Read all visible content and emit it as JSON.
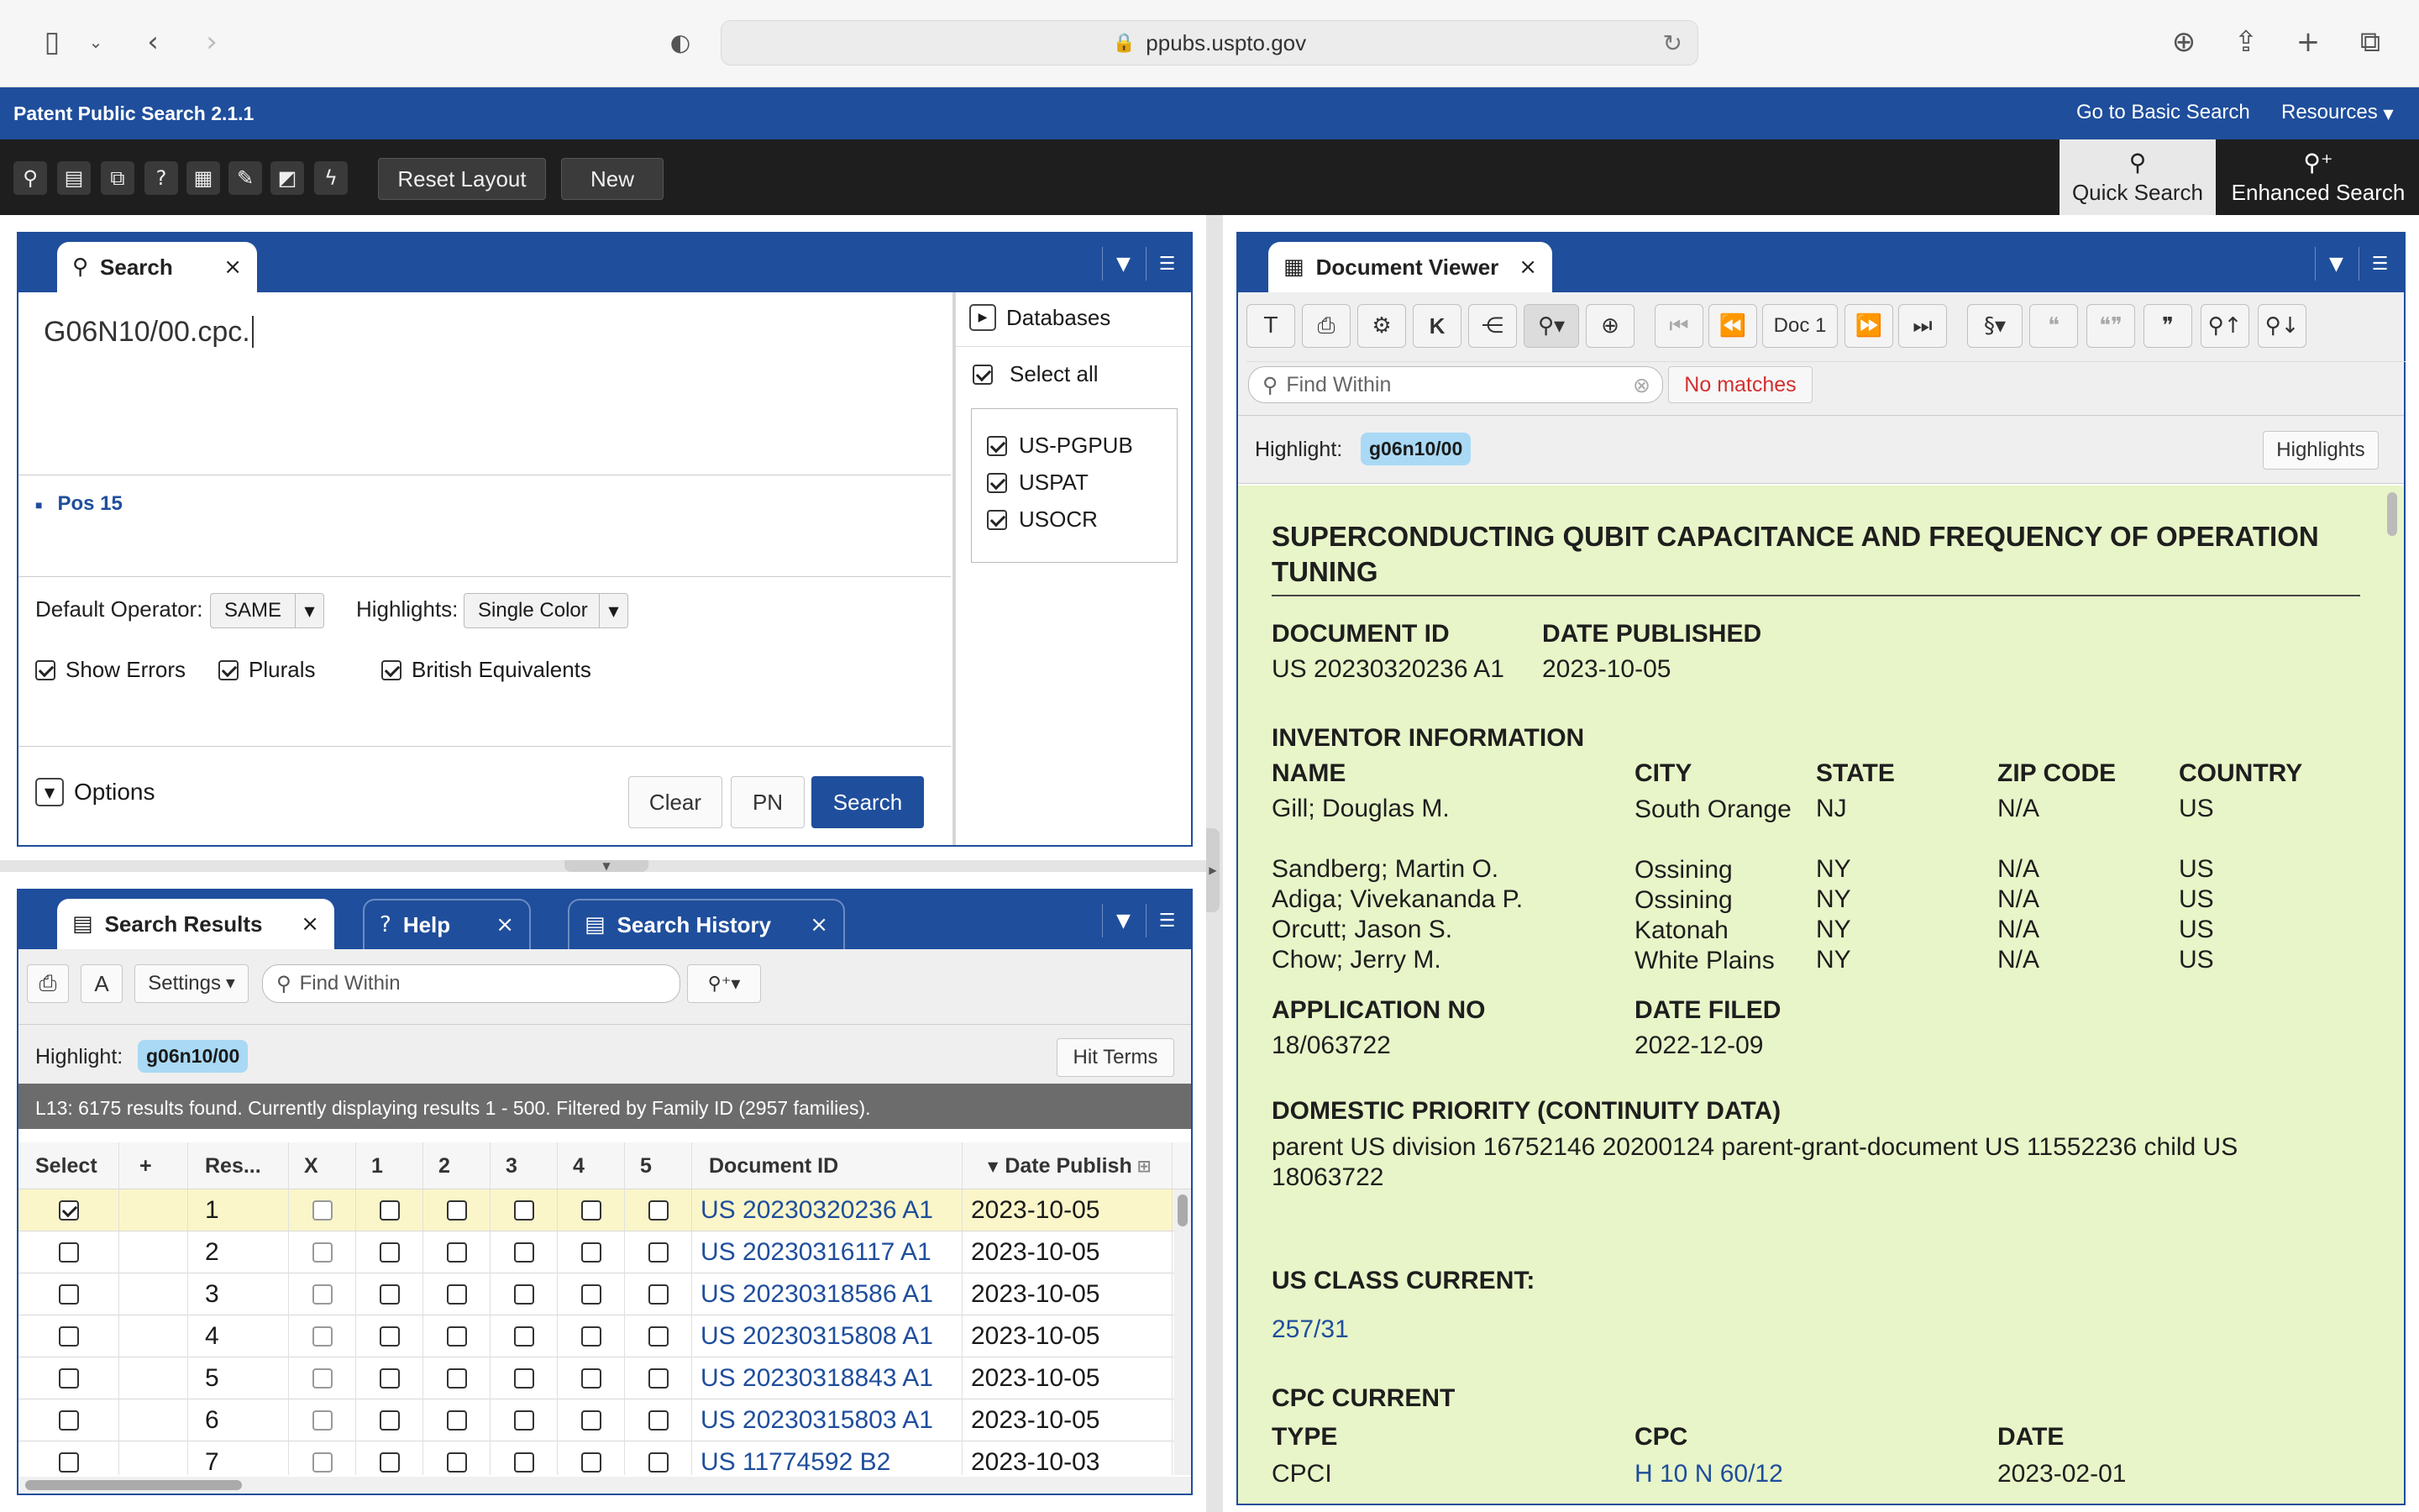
{
  "browser": {
    "url": "ppubs.uspto.gov"
  },
  "app": {
    "title": "Patent Public Search 2.1.1",
    "basic_search_link": "Go to Basic Search",
    "resources_menu": "Resources"
  },
  "toolbar": {
    "reset_layout": "Reset Layout",
    "new": "New",
    "quick_search": "Quick Search",
    "enhanced_search": "Enhanced Search"
  },
  "search_panel": {
    "tab_label": "Search",
    "query": "G06N10/00.cpc.",
    "cursor_info": "Pos 15",
    "default_operator_label": "Default Operator:",
    "default_operator_value": "SAME",
    "highlights_label": "Highlights:",
    "highlights_value": "Single Color",
    "show_errors": "Show Errors",
    "plurals": "Plurals",
    "british_equivalents": "British Equivalents",
    "options": "Options",
    "clear": "Clear",
    "pn": "PN",
    "search": "Search",
    "databases": {
      "title": "Databases",
      "select_all": "Select all",
      "items": [
        "US-PGPUB",
        "USPAT",
        "USOCR"
      ]
    }
  },
  "results_panel": {
    "tabs": [
      "Search Results",
      "Help",
      "Search History"
    ],
    "settings": "Settings",
    "find_within_placeholder": "Find Within",
    "highlight_label": "Highlight:",
    "highlight_term": "g06n10/00",
    "hit_terms": "Hit Terms",
    "status": "L13:  6175 results found. Currently displaying results 1 - 500. Filtered by Family ID (2957 families).",
    "columns": [
      "Select",
      "+",
      "Res...",
      "X",
      "1",
      "2",
      "3",
      "4",
      "5",
      "Document ID",
      "Date Publish"
    ],
    "rows": [
      {
        "num": "1",
        "doc_id": "US 20230320236 A1",
        "date": "2023-10-05",
        "selected": true
      },
      {
        "num": "2",
        "doc_id": "US 20230316117 A1",
        "date": "2023-10-05",
        "selected": false
      },
      {
        "num": "3",
        "doc_id": "US 20230318586 A1",
        "date": "2023-10-05",
        "selected": false
      },
      {
        "num": "4",
        "doc_id": "US 20230315808 A1",
        "date": "2023-10-05",
        "selected": false
      },
      {
        "num": "5",
        "doc_id": "US 20230318843 A1",
        "date": "2023-10-05",
        "selected": false
      },
      {
        "num": "6",
        "doc_id": "US 20230315803 A1",
        "date": "2023-10-05",
        "selected": false
      },
      {
        "num": "7",
        "doc_id": "US 11774592 B2",
        "date": "2023-10-03",
        "selected": false
      }
    ]
  },
  "doc_viewer": {
    "tab_label": "Document Viewer",
    "doc_nav": "Doc 1",
    "find_within_placeholder": "Find Within",
    "no_matches": "No matches",
    "highlight_label": "Highlight:",
    "highlight_term": "g06n10/00",
    "highlights_button": "Highlights",
    "title": "SUPERCONDUCTING QUBIT CAPACITANCE AND FREQUENCY OF OPERATION TUNING",
    "document_id_label": "DOCUMENT ID",
    "document_id": "US 20230320236 A1",
    "date_published_label": "DATE PUBLISHED",
    "date_published": "2023-10-05",
    "inventor_heading": "INVENTOR INFORMATION",
    "inventor_columns": [
      "NAME",
      "CITY",
      "STATE",
      "ZIP CODE",
      "COUNTRY"
    ],
    "inventors": [
      {
        "name": "Gill; Douglas M.",
        "city": "South Orange",
        "state": "NJ",
        "zip": "N/A",
        "country": "US"
      },
      {
        "name": "Sandberg; Martin O.",
        "city": "Ossining",
        "state": "NY",
        "zip": "N/A",
        "country": "US"
      },
      {
        "name": "Adiga; Vivekananda P.",
        "city": "Ossining",
        "state": "NY",
        "zip": "N/A",
        "country": "US"
      },
      {
        "name": "Orcutt; Jason S.",
        "city": "Katonah",
        "state": "NY",
        "zip": "N/A",
        "country": "US"
      },
      {
        "name": "Chow; Jerry M.",
        "city": "White Plains",
        "state": "NY",
        "zip": "N/A",
        "country": "US"
      }
    ],
    "application_no_label": "APPLICATION NO",
    "application_no": "18/063722",
    "date_filed_label": "DATE FILED",
    "date_filed": "2022-12-09",
    "domestic_priority_heading": "DOMESTIC PRIORITY (CONTINUITY DATA)",
    "domestic_priority_text": "parent US division 16752146 20200124 parent-grant-document US 11552236 child US 18063722",
    "us_class_heading": "US CLASS CURRENT:",
    "us_class_value": "257/31",
    "cpc_heading": "CPC CURRENT",
    "cpc_columns": [
      "TYPE",
      "CPC",
      "DATE"
    ],
    "cpc_row": {
      "type": "CPCI",
      "cpc": "H 10 N 60/12",
      "date": "2023-02-01"
    }
  }
}
